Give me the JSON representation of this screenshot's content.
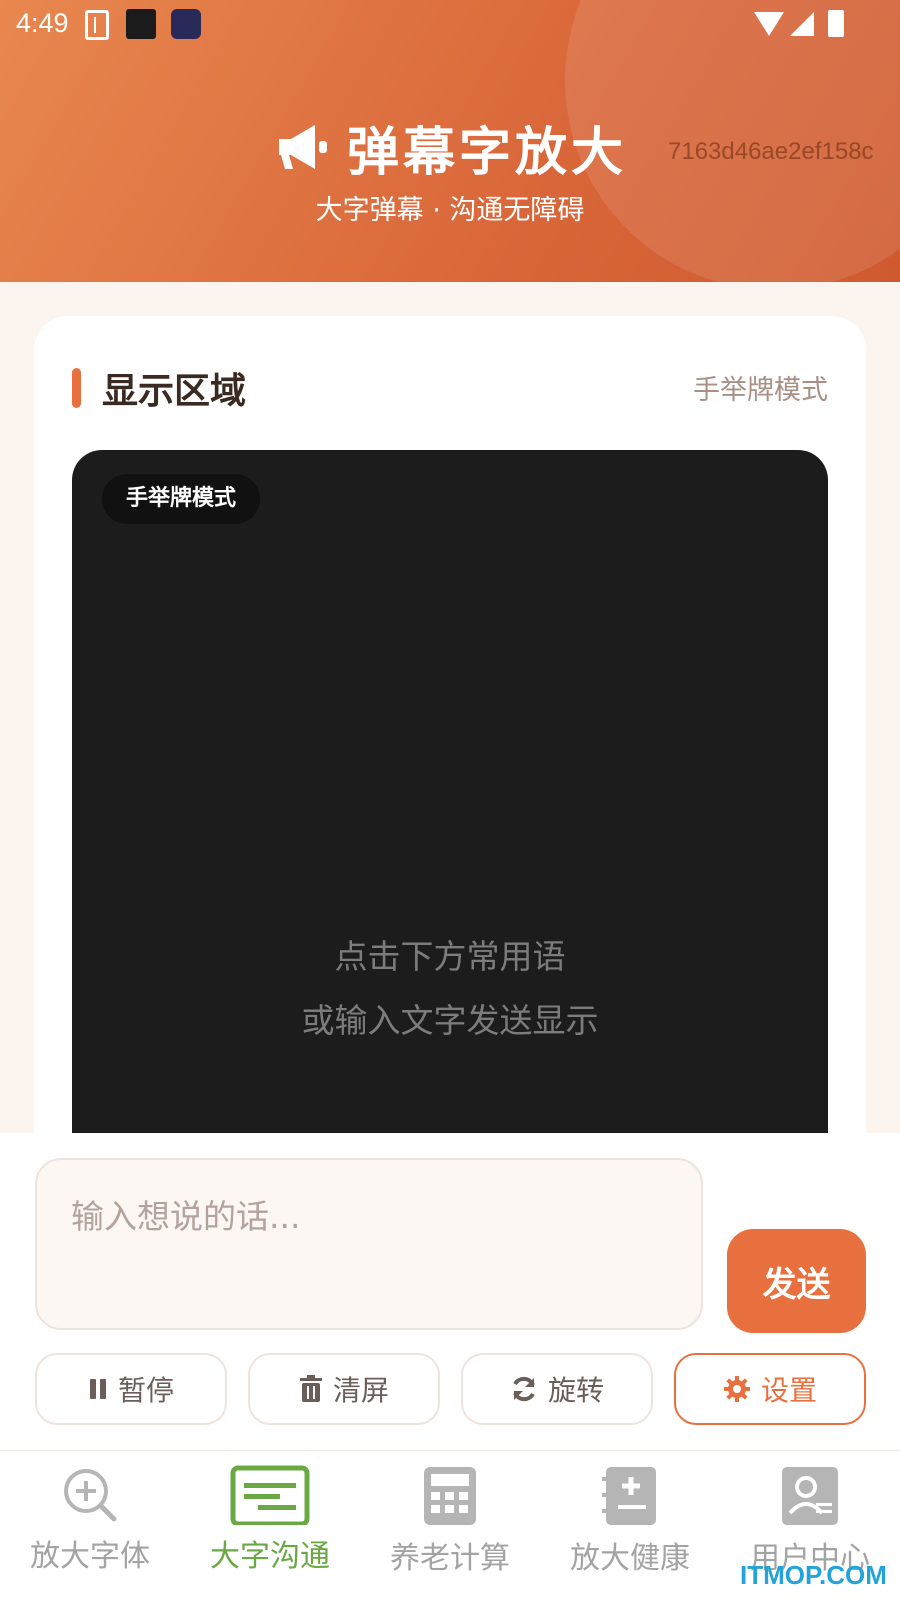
{
  "status_bar": {
    "time": "4:49"
  },
  "header": {
    "title": "弹幕字放大",
    "subtitle": "大字弹幕 · 沟通无障碍",
    "hash": "7163d46ae2ef158c"
  },
  "display_card": {
    "title": "显示区域",
    "mode_link": "手举牌模式",
    "mode_chip": "手举牌模式",
    "hint_line1": "点击下方常用语",
    "hint_line2": "或输入文字发送显示"
  },
  "input": {
    "placeholder": "输入想说的话...",
    "value": ""
  },
  "send_button": "发送",
  "controls": [
    {
      "label": "暂停",
      "icon": "pause-icon"
    },
    {
      "label": "清屏",
      "icon": "trash-icon"
    },
    {
      "label": "旋转",
      "icon": "refresh-icon"
    },
    {
      "label": "设置",
      "icon": "gear-icon"
    }
  ],
  "tabs": [
    {
      "label": "放大字体",
      "icon": "zoom-in-icon",
      "active": false
    },
    {
      "label": "大字沟通",
      "icon": "message-lines-icon",
      "active": true
    },
    {
      "label": "养老计算",
      "icon": "calculator-icon",
      "active": false
    },
    {
      "label": "放大健康",
      "icon": "medical-book-icon",
      "active": false
    },
    {
      "label": "用户中心",
      "icon": "user-card-icon",
      "active": false
    }
  ],
  "watermark": "ITMOP.COM",
  "colors": {
    "accent": "#e8703f",
    "active_tab": "#6aa843",
    "display_bg": "#1c1c1c"
  }
}
